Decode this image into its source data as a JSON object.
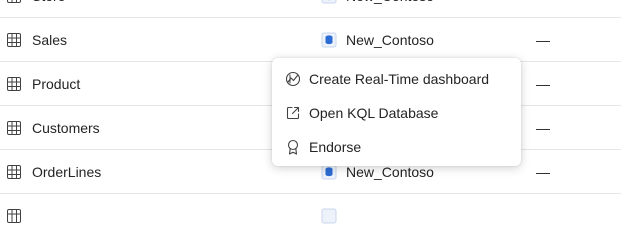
{
  "rows": [
    {
      "name": "Store",
      "location": "New_Contoso",
      "extra": ""
    },
    {
      "name": "Sales",
      "location": "New_Contoso",
      "extra": "—"
    },
    {
      "name": "Product",
      "location": "",
      "extra": "—"
    },
    {
      "name": "Customers",
      "location": "",
      "extra": "—"
    },
    {
      "name": "OrderLines",
      "location": "New_Contoso",
      "extra": "—"
    }
  ],
  "context_menu": {
    "items": [
      {
        "label": "Create Real-Time dashboard",
        "icon": "realtime-dashboard-icon"
      },
      {
        "label": "Open KQL Database",
        "icon": "open-external-icon"
      },
      {
        "label": "Endorse",
        "icon": "endorse-ribbon-icon"
      }
    ]
  },
  "icons": {
    "row_icon": "table-icon",
    "location_icon": "kql-database-icon"
  },
  "colors": {
    "db_icon_blue": "#2b6cd4",
    "divider": "#e6e6e6"
  }
}
